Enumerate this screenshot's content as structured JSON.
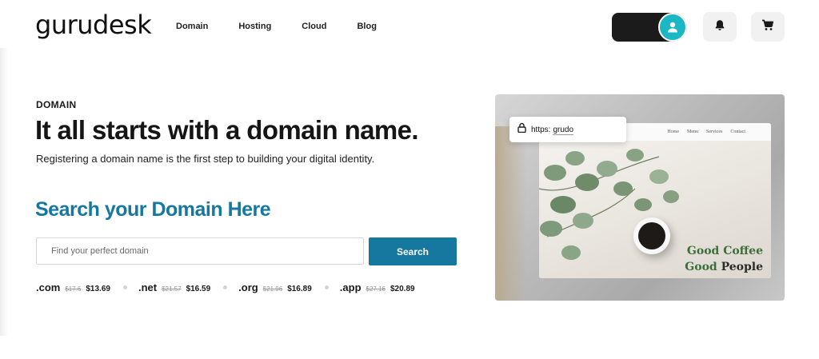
{
  "brand": {
    "logo_text": "gurudesk"
  },
  "nav": {
    "items": [
      "Domain",
      "Hosting",
      "Cloud",
      "Blog"
    ]
  },
  "header": {
    "avatar_icon": "user-icon",
    "bell_icon": "bell-icon",
    "cart_icon": "cart-icon",
    "accent_color": "#1cb7c4"
  },
  "hero": {
    "eyebrow": "DOMAIN",
    "headline": "It all starts with a domain name.",
    "subline": "Registering a domain name is the first step to building your digital identity."
  },
  "search": {
    "title": "Search your Domain Here",
    "placeholder": "Find your perfect domain",
    "value": "",
    "button_label": "Search",
    "accent_color": "#16789f"
  },
  "tlds": [
    {
      "name": ".com",
      "old_price": "$17.6",
      "price": "$13.69"
    },
    {
      "name": ".net",
      "old_price": "$21.57",
      "price": "$16.59"
    },
    {
      "name": ".org",
      "old_price": "$21.96",
      "price": "$16.89"
    },
    {
      "name": ".app",
      "old_price": "$27.16",
      "price": "$20.89"
    }
  ],
  "preview": {
    "url_scheme": "https:",
    "url_name": "grudo",
    "mock_nav": [
      "Home",
      "Menu",
      "Services",
      "Contact"
    ],
    "tagline_line1_a": "Good",
    "tagline_line1_b": "Coffee",
    "tagline_line2_a": "Good",
    "tagline_line2_b": "People"
  }
}
